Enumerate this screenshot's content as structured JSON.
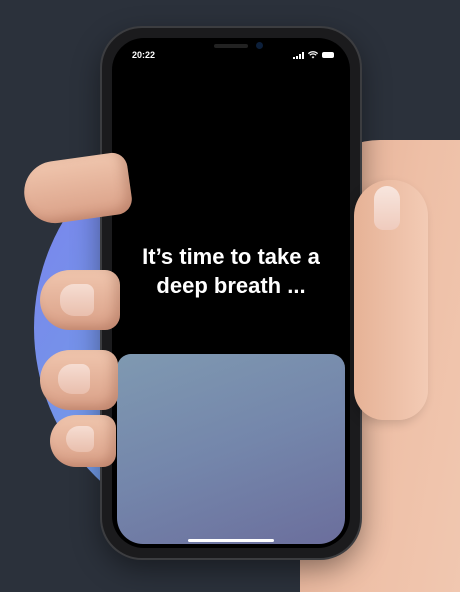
{
  "status_bar": {
    "time": "20:22",
    "icons": [
      "signal-icon",
      "wifi-icon",
      "battery-icon"
    ]
  },
  "main": {
    "headline_line1": "It’s time to take a",
    "headline_line2": "deep breath ..."
  },
  "colors": {
    "background": "#2b313b",
    "screen": "#000000",
    "panel_gradient_start": "#7f99b1",
    "panel_gradient_end": "#6b6e9c",
    "circle_gradient_start": "#7c82ee",
    "circle_gradient_end": "#5cd6d6"
  }
}
